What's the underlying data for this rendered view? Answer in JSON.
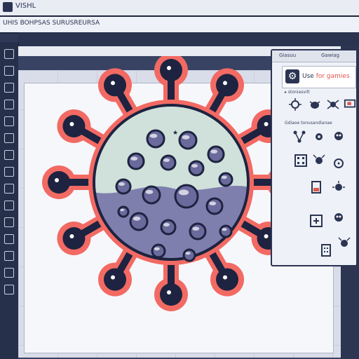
{
  "window": {
    "title": "VISHL",
    "menu_text": "UHIS BOHPSAS SURUSREURSA"
  },
  "panel": {
    "tab_left": "Giasuu",
    "tab_right": "Gawiag",
    "header_label_prefix": "Use ",
    "header_label_highlight": "for gamies",
    "section_top": "▸ stoniasvilt",
    "section_bottom": "Gdiaoe tonusandianae"
  },
  "colors": {
    "accent_red": "#e3554d",
    "navy": "#2b3452",
    "virus_top": "#cfe1da",
    "virus_bottom": "#7f7fae",
    "virus_outline": "#1d2340",
    "spike_glow": "#f26a63"
  },
  "icons": [
    "gear-icon",
    "virus-icon",
    "bug-icon",
    "spider-icon",
    "monitor-icon",
    "network-icon",
    "virus-icon",
    "skull-icon",
    "keypad-icon",
    "germ-icon",
    "virus-icon",
    "battery-icon",
    "virus-icon",
    "crossbox-icon",
    "skull-icon",
    "document-icon",
    "germ-icon"
  ]
}
